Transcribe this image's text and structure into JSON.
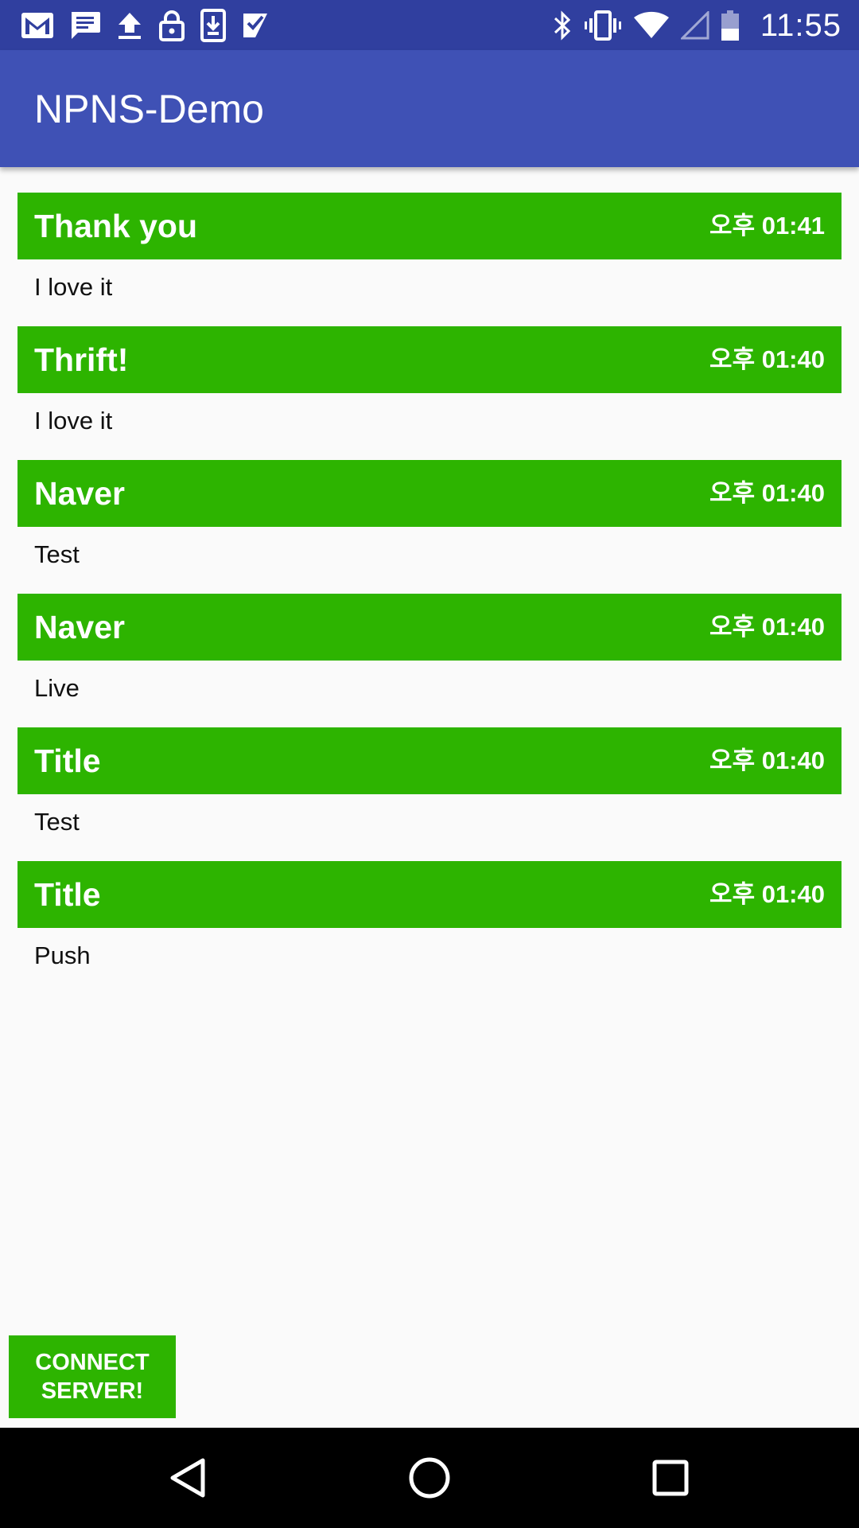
{
  "status_bar": {
    "time": "11:55",
    "left_icons": [
      "gmail-icon",
      "message-icon",
      "upload-icon",
      "lock-icon",
      "download-icon",
      "tasks-icon"
    ],
    "right_icons": [
      "bluetooth-icon",
      "vibrate-icon",
      "wifi-icon",
      "signal-icon",
      "battery-icon"
    ]
  },
  "app_bar": {
    "title": "NPNS-Demo"
  },
  "messages": [
    {
      "title": "Thank you",
      "time": "오후 01:41",
      "body": "I love it"
    },
    {
      "title": "Thrift!",
      "time": "오후 01:40",
      "body": "I love it"
    },
    {
      "title": "Naver",
      "time": "오후 01:40",
      "body": "Test"
    },
    {
      "title": "Naver",
      "time": "오후 01:40",
      "body": "Live"
    },
    {
      "title": "Title",
      "time": "오후 01:40",
      "body": "Test"
    },
    {
      "title": "Title",
      "time": "오후 01:40",
      "body": "Push"
    }
  ],
  "connect_button": {
    "label": "CONNECT\nSERVER!"
  },
  "nav_bar": {
    "icons": [
      "back-icon",
      "home-icon",
      "recents-icon"
    ]
  },
  "colors": {
    "status_bar": "#303f9f",
    "app_bar": "#3f51b5",
    "accent_green": "#2db400",
    "background": "#fafafa"
  }
}
